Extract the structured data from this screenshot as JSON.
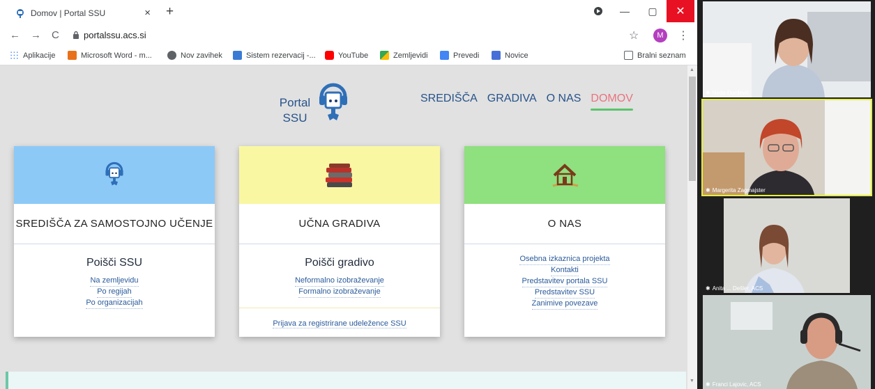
{
  "browser": {
    "tab_title": "Domov | Portal SSU",
    "tab_close": "×",
    "new_tab": "+",
    "url": "portalssu.acs.si",
    "profile_initial": "M",
    "window_controls": {
      "minimize": "—",
      "maximize": "▢",
      "close": "✕"
    },
    "nav": {
      "back": "←",
      "forward": "→",
      "reload": "C",
      "star": "☆",
      "menu": "⋮"
    },
    "bookmarks": [
      {
        "label": "Aplikacije",
        "icon": "apps-grid-icon",
        "color": "#4285f4"
      },
      {
        "label": "Microsoft Word - m...",
        "icon": "word-doc-icon",
        "color": "#e8711a"
      },
      {
        "label": "Nov zavihek",
        "icon": "globe-icon",
        "color": "#5f6368"
      },
      {
        "label": "Sistem rezervacij -...",
        "icon": "calendar-icon",
        "color": "#3a7bd5"
      },
      {
        "label": "YouTube",
        "icon": "youtube-icon",
        "color": "#ff0000"
      },
      {
        "label": "Zemljevidi",
        "icon": "maps-icon",
        "color": "#34a853"
      },
      {
        "label": "Prevedi",
        "icon": "translate-icon",
        "color": "#4285f4"
      },
      {
        "label": "Novice",
        "icon": "news-icon",
        "color": "#4670d8"
      }
    ],
    "reading_list": "Bralni seznam"
  },
  "page": {
    "logo_line1": "Portal",
    "logo_line2": "SSU",
    "nav": [
      "SREDIŠČA",
      "GRADIVA",
      "O NAS",
      "DOMOV"
    ],
    "active_nav": "DOMOV",
    "cards": [
      {
        "title": "SREDIŠČA ZA SAMOSTOJNO UČENJE",
        "banner_color": "#8cc9f7",
        "subtitle": "Poišči SSU",
        "links": [
          "Na zemljevidu",
          "Po regijah",
          "Po organizacijah"
        ]
      },
      {
        "title": "UČNA GRADIVA",
        "banner_color": "#faf7a3",
        "subtitle": "Poišči gradivo",
        "links": [
          "Neformalno izobraževanje",
          "Formalno izobraževanje"
        ],
        "extra_link": "Prijava za registrirane udeležence SSU"
      },
      {
        "title": "O NAS",
        "banner_color": "#8fe07e",
        "links": [
          "Osebna izkaznica projekta",
          "Kontakti",
          "Predstavitev portala SSU",
          "Predstavitev SSU",
          "Zanimive povezave"
        ]
      }
    ]
  },
  "participants": [
    {
      "name": "Neda Đorđević",
      "pinned": true
    },
    {
      "name": "Margerita Zagmajster",
      "pinned": true,
      "active_speaker": true
    },
    {
      "name": "Anita ... Dešler, ACS",
      "pinned": true
    },
    {
      "name": "Franci Lajovic, ACS",
      "pinned": true
    }
  ]
}
